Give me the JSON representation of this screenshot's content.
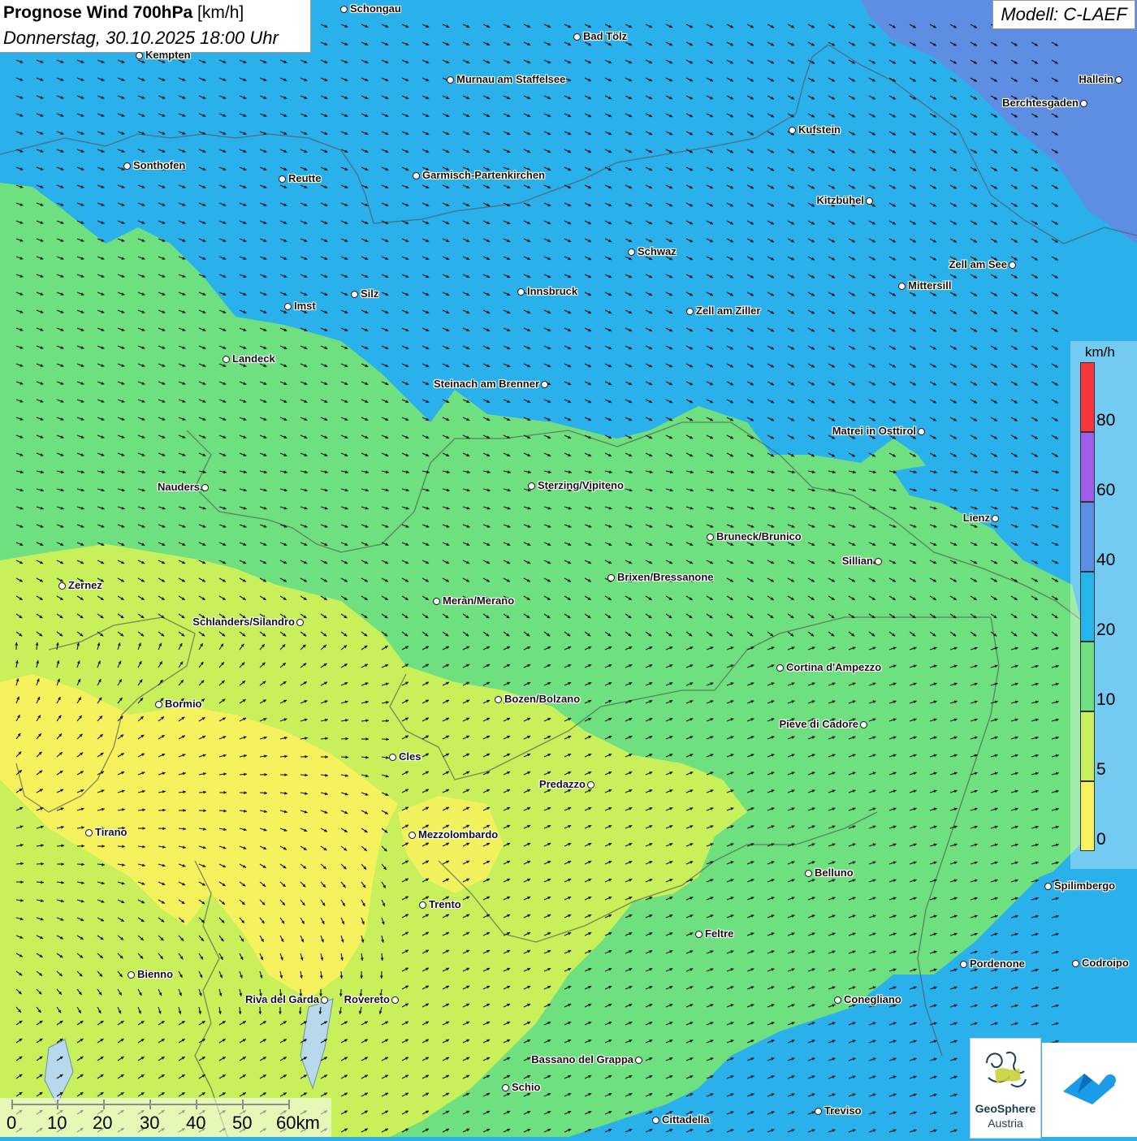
{
  "header": {
    "title_bold": "Prognose Wind 700hPa",
    "title_unit": "[km/h]",
    "datetime": "Donnerstag, 30.10.2025 18:00 Uhr"
  },
  "model": {
    "label": "Modell: C-LAEF"
  },
  "legend": {
    "unit": "km/h",
    "labels": [
      "80",
      "60",
      "40",
      "20",
      "10",
      "5",
      "0"
    ],
    "colors": [
      "#f7353a",
      "#9f5ee9",
      "#5b8ee5",
      "#24b6ea",
      "#6fe07f",
      "#c7f05b",
      "#f7f25e"
    ]
  },
  "cities": [
    {
      "name": "Schongau"
    },
    {
      "name": "Kempten"
    },
    {
      "name": "Bad Tölz"
    },
    {
      "name": "Murnau am Staffelsee"
    },
    {
      "name": "Hallein"
    },
    {
      "name": "Berchtesgaden"
    },
    {
      "name": "Kufstein"
    },
    {
      "name": "Sonthofen"
    },
    {
      "name": "Reutte"
    },
    {
      "name": "Garmisch-Partenkirchen"
    },
    {
      "name": "Kitzbühel"
    },
    {
      "name": "Schwaz"
    },
    {
      "name": "Zell am See"
    },
    {
      "name": "Mittersill"
    },
    {
      "name": "Innsbruck"
    },
    {
      "name": "Silz"
    },
    {
      "name": "Imst"
    },
    {
      "name": "Zell am Ziller"
    },
    {
      "name": "Landeck"
    },
    {
      "name": "Steinach am Brenner"
    },
    {
      "name": "Matrei in Osttirol"
    },
    {
      "name": "Nauders"
    },
    {
      "name": "Sterzing/Vipiteno"
    },
    {
      "name": "Lienz"
    },
    {
      "name": "Bruneck/Brunico"
    },
    {
      "name": "Sillian"
    },
    {
      "name": "Zernez"
    },
    {
      "name": "Brixen/Bressanone"
    },
    {
      "name": "Meran/Merano"
    },
    {
      "name": "Schlanders/Silandro"
    },
    {
      "name": "Cortina d'Ampezzo"
    },
    {
      "name": "Bozen/Bolzano"
    },
    {
      "name": "Bormio"
    },
    {
      "name": "Pieve di Cadore"
    },
    {
      "name": "Cles"
    },
    {
      "name": "Predazzo"
    },
    {
      "name": "Tirano"
    },
    {
      "name": "Mezzolombardo"
    },
    {
      "name": "Belluno"
    },
    {
      "name": "Spilimbergo"
    },
    {
      "name": "Trento"
    },
    {
      "name": "Feltre"
    },
    {
      "name": "Pordenone"
    },
    {
      "name": "Codroipo"
    },
    {
      "name": "Bienno"
    },
    {
      "name": "Riva del Garda"
    },
    {
      "name": "Rovereto"
    },
    {
      "name": "Conegliano"
    },
    {
      "name": "Bassano del Grappa"
    },
    {
      "name": "Schio"
    },
    {
      "name": "Treviso"
    },
    {
      "name": "Cittadella"
    }
  ],
  "scalebar": {
    "labels": [
      "0",
      "10",
      "20",
      "30",
      "40",
      "50",
      "60km"
    ]
  },
  "logo": {
    "line1": "GeoSphere",
    "line2": "Austria"
  }
}
